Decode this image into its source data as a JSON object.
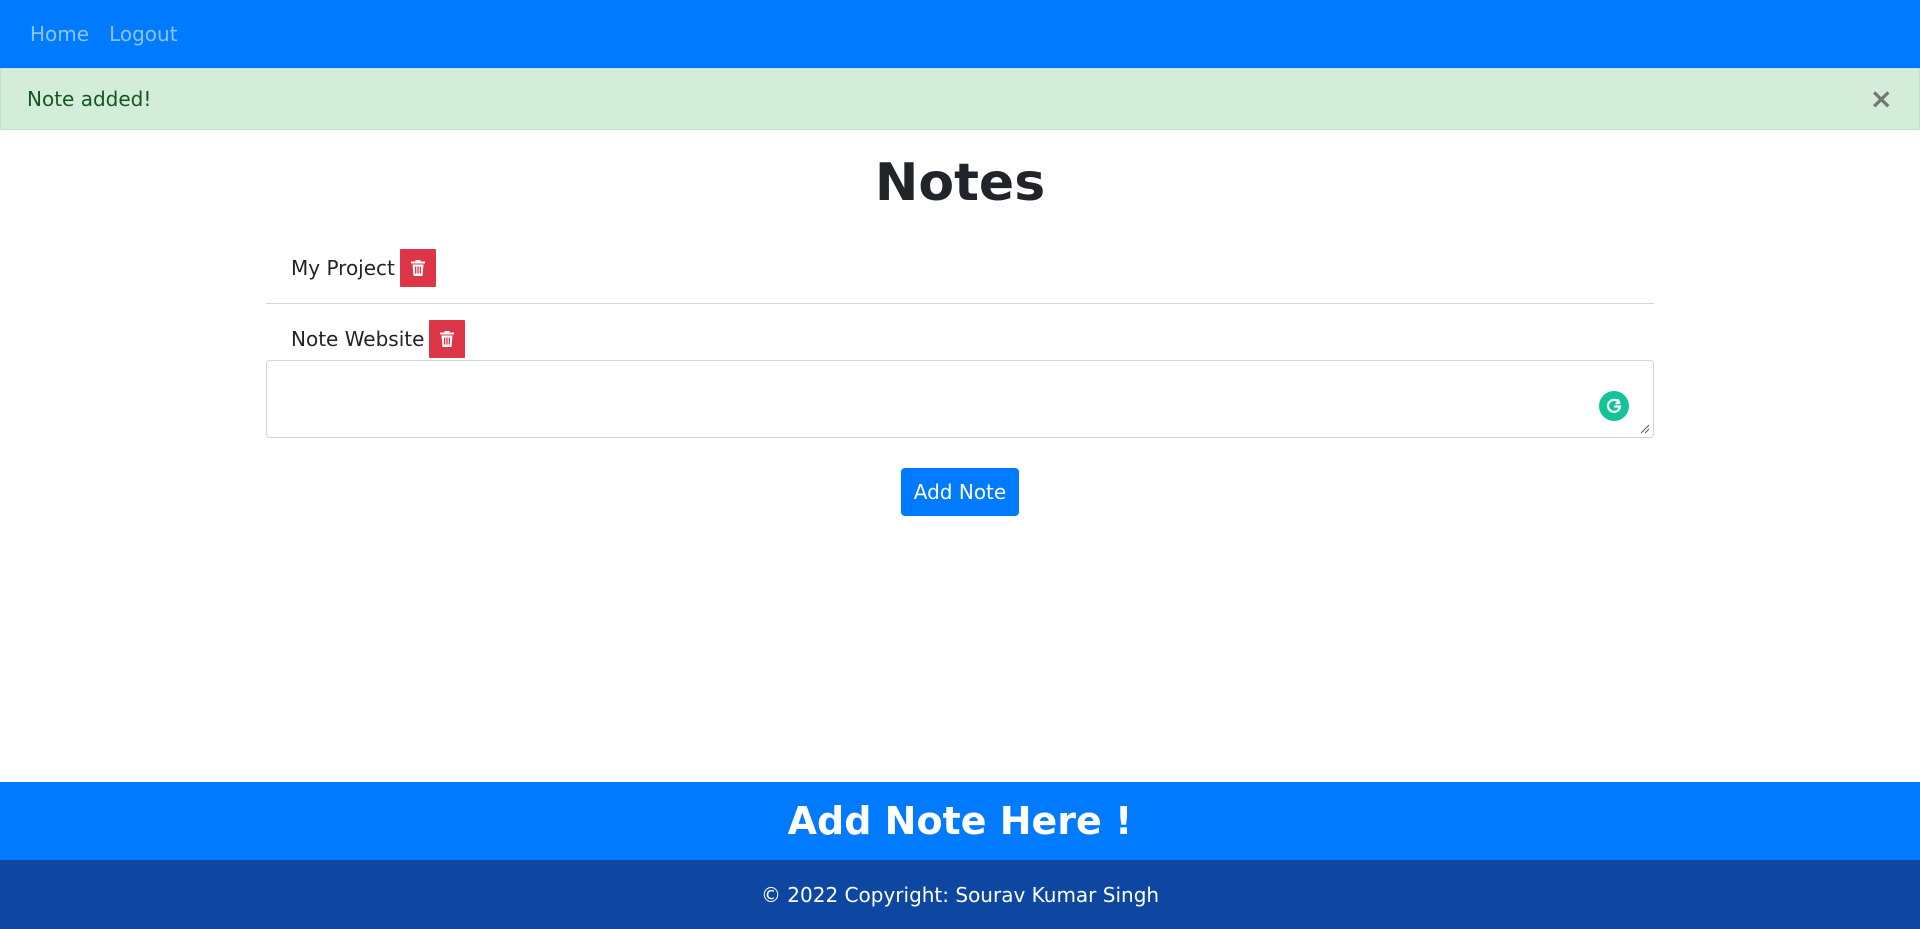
{
  "navbar": {
    "links": [
      {
        "label": "Home"
      },
      {
        "label": "Logout"
      }
    ]
  },
  "alert": {
    "message": "Note added!",
    "close_label": "×"
  },
  "main": {
    "title": "Notes",
    "notes": [
      {
        "text": "My Project"
      },
      {
        "text": "Note Website"
      }
    ],
    "textarea": {
      "value": "",
      "placeholder": ""
    },
    "add_button_label": "Add Note"
  },
  "footer": {
    "banner": "Add Note Here !",
    "copyright": "© 2022 Copyright: Sourav Kumar Singh"
  },
  "colors": {
    "primary": "#007bff",
    "danger": "#dc3545",
    "success_bg": "#d4edda",
    "footer_dark": "#0d47a1",
    "grammarly": "#15c39a"
  },
  "icons": {
    "delete": "trash-icon",
    "close": "close-icon",
    "grammarly": "grammarly-icon"
  }
}
